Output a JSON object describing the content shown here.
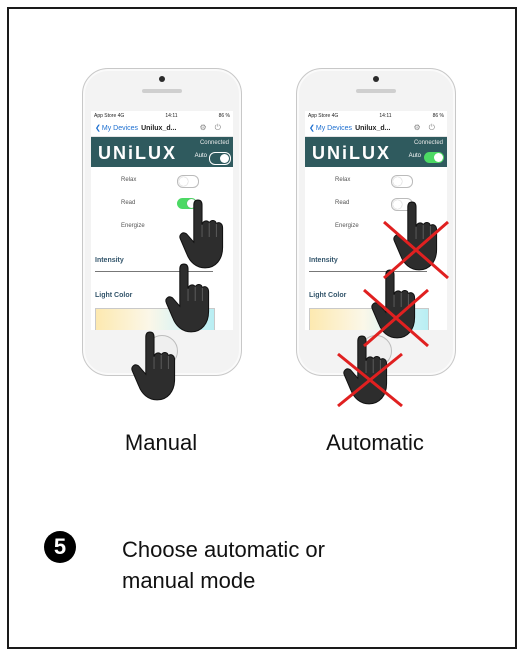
{
  "phone": {
    "carrier": "App Store",
    "network": "4G",
    "time": "14:11",
    "battery": "86 %",
    "back_label": "My Devices",
    "device_name": "Unilux_d...",
    "brand": "UNiLUX",
    "connected": "Connected",
    "auto": "Auto",
    "modes": [
      "Relax",
      "Read",
      "Energize"
    ],
    "intensity": "Intensity",
    "light_color": "Light Color"
  },
  "labels": {
    "manual": "Manual",
    "automatic": "Automatic"
  },
  "step": {
    "number": "5",
    "text_line1": "Choose automatic or",
    "text_line2": "manual mode"
  },
  "colors": {
    "brand_bar": "#2f5a5e",
    "toggle_on": "#4cd964",
    "cross": "#e02020"
  },
  "icons": [
    "hand-pointer-icon",
    "cross-icon",
    "gear-icon",
    "power-icon",
    "back-chevron-icon"
  ]
}
